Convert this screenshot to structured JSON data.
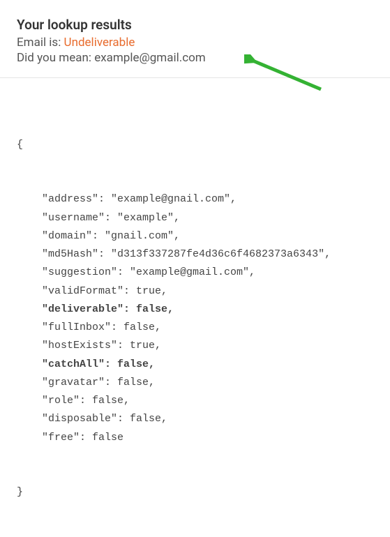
{
  "header": {
    "title": "Your lookup results",
    "status_label": "Email is: ",
    "status_value": "Undeliverable",
    "suggest_label": "Did you mean: ",
    "suggest_value": "example@gmail.com"
  },
  "json": {
    "open": "{",
    "close": "}",
    "rows": [
      {
        "key": "address",
        "value": "\"example@gnail.com\"",
        "bold": false
      },
      {
        "key": "username",
        "value": "\"example\"",
        "bold": false
      },
      {
        "key": "domain",
        "value": "\"gnail.com\"",
        "bold": false
      },
      {
        "key": "md5Hash",
        "value": "\"d313f337287fe4d36c6f4682373a6343\"",
        "bold": false
      },
      {
        "key": "suggestion",
        "value": "\"example@gmail.com\"",
        "bold": false
      },
      {
        "key": "validFormat",
        "value": "true",
        "bold": false
      },
      {
        "key": "deliverable",
        "value": "false",
        "bold": true
      },
      {
        "key": "fullInbox",
        "value": "false",
        "bold": false
      },
      {
        "key": "hostExists",
        "value": "true",
        "bold": false
      },
      {
        "key": "catchAll",
        "value": "false",
        "bold": true
      },
      {
        "key": "gravatar",
        "value": "false",
        "bold": false
      },
      {
        "key": "role",
        "value": "false",
        "bold": false
      },
      {
        "key": "disposable",
        "value": "false",
        "bold": false
      },
      {
        "key": "free",
        "value": "false",
        "bold": false
      }
    ]
  },
  "colors": {
    "accent": "#e86c2e",
    "arrow": "#34b233"
  }
}
